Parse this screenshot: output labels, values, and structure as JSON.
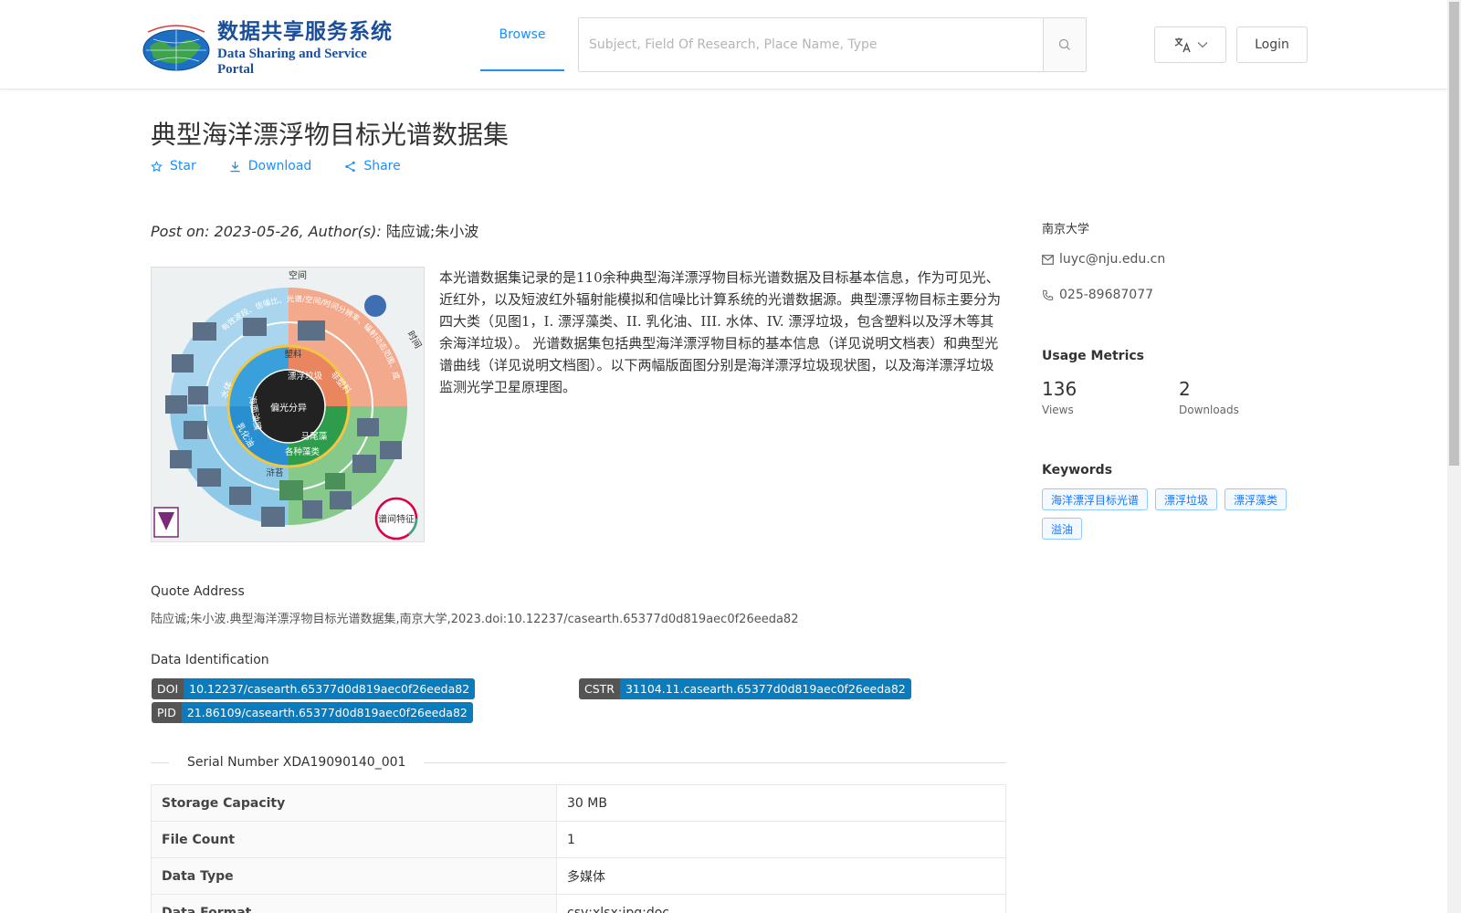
{
  "header": {
    "logo_cn": "数据共享服务系统",
    "logo_en": "Data Sharing and Service Portal",
    "nav_browse": "Browse",
    "search_placeholder": "Subject, Field Of Research, Place Name, Type",
    "login_label": "Login"
  },
  "dataset": {
    "title": "典型海洋漂浮物目标光谱数据集",
    "actions": {
      "star": "Star",
      "download": "Download",
      "share": "Share"
    },
    "posted_prefix": "Post on: 2023-05-26, Author(s): ",
    "authors": "陆应诚;朱小波",
    "description": "本光谱数据集记录的是110余种典型海洋漂浮物目标光谱数据及目标基本信息，作为可见光、近红外，以及短波红外辐射能模拟和信噪比计算系统的光谱数据源。典型漂浮物目标主要分为四大类（见图1，I. 漂浮藻类、II. 乳化油、III. 水体、IV. 漂浮垃圾，包含塑料以及浮木等其余海洋垃圾）。 光谱数据集包括典型海洋漂浮物目标的基本信息（详见说明文档表）和典型光谱曲线（详见说明文档图）。以下两幅版面图分别是海洋漂浮垃圾现状图，以及海洋漂浮垃圾监测光学卫星原理图。",
    "quote_label": "Quote Address",
    "quote": "陆应诚;朱小波.典型海洋漂浮物目标光谱数据集,南京大学,2023.doi:10.12237/casearth.65377d0d819aec0f26eeda82",
    "id_label": "Data Identification",
    "doi_key": "DOI",
    "doi": "10.12237/casearth.65377d0d819aec0f26eeda82",
    "cstr_key": "CSTR",
    "cstr": "31104.11.casearth.65377d0d819aec0f26eeda82",
    "pid_key": "PID",
    "pid": "21.86109/casearth.65377d0d819aec0f26eeda82",
    "serial": "Serial Number XDA19090140_001",
    "table": [
      {
        "k": "Storage Capacity",
        "v": "30 MB"
      },
      {
        "k": "File Count",
        "v": "1"
      },
      {
        "k": "Data Type",
        "v": "多媒体"
      },
      {
        "k": "Data Format",
        "v": "csv;xlsx;jpg;doc"
      }
    ]
  },
  "sidebar": {
    "org": "南京大学",
    "email": "luyc@nju.edu.cn",
    "phone": "025-89687077",
    "metrics_title": "Usage Metrics",
    "views": "136",
    "views_label": "Views",
    "downloads": "2",
    "downloads_label": "Downloads",
    "keywords_title": "Keywords",
    "keywords": [
      "海洋漂浮目标光谱",
      "漂浮垃圾",
      "漂浮藻类",
      "溢油"
    ]
  },
  "figure": {
    "label_center": "偏光分异",
    "label_space": "空间",
    "label_time": "时间",
    "label_spectrum": "谱间特征",
    "label_outer": "有效波段、信噪比、光谱/空间/时间分辨率、辐射动态范围、成像及测量几何模拟",
    "ring_labels": [
      "塑料",
      "漂浮垃圾",
      "非塑料",
      "各种藻类",
      "马尾藻",
      "浒苔",
      "乳化油",
      "海面油膜",
      "水体"
    ]
  }
}
